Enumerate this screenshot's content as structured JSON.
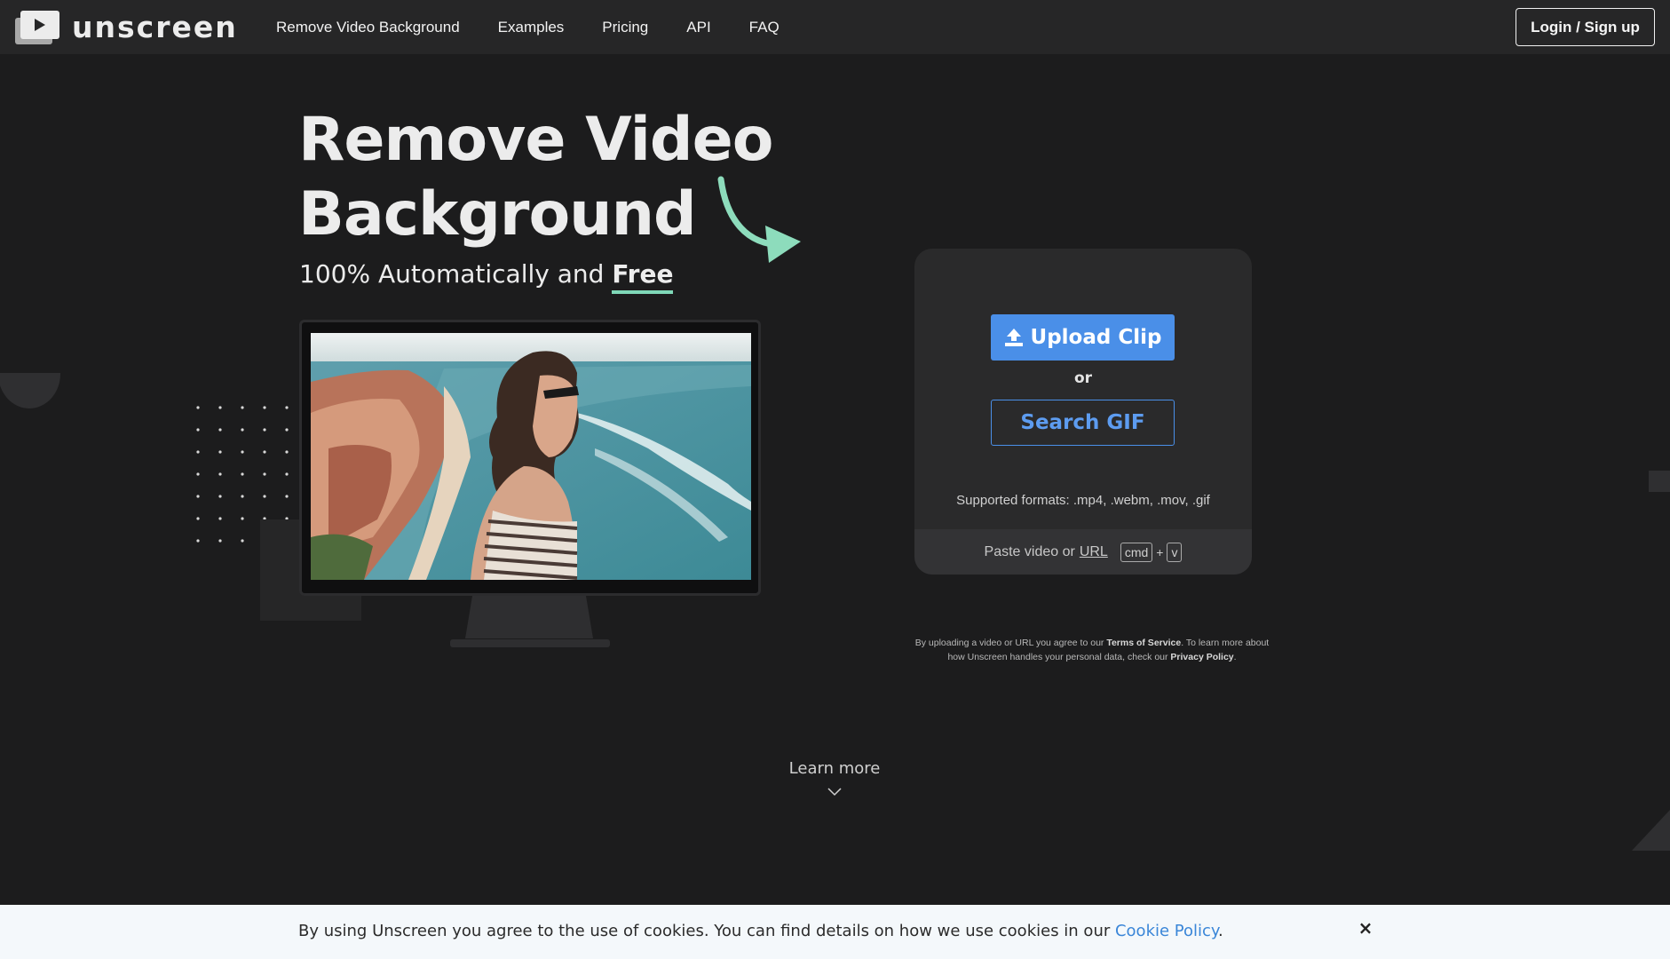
{
  "brand": {
    "name": "unscreen",
    "logo_icon": "play-screen-icon"
  },
  "nav": {
    "links": [
      "Remove Video Background",
      "Examples",
      "Pricing",
      "API",
      "FAQ"
    ],
    "login_label": "Login / Sign up"
  },
  "hero": {
    "title_line1": "Remove Video",
    "title_line2": "Background",
    "subtitle_prefix": "100% Automatically and ",
    "subtitle_emphasis": "Free"
  },
  "upload": {
    "upload_label": "Upload Clip",
    "upload_icon": "upload-icon",
    "or_label": "or",
    "search_label": "Search GIF",
    "formats": "Supported formats: .mp4, .webm, .mov, .gif",
    "paste_prefix": "Paste video or",
    "paste_url": "URL",
    "key_cmd": "cmd",
    "key_plus": "+",
    "key_v": "v"
  },
  "legal": {
    "part1": "By uploading a video or URL you agree to our ",
    "tos": "Terms of Service",
    "part2": ". To learn more about how Unscreen handles your personal data, check our ",
    "privacy": "Privacy Policy",
    "part3": "."
  },
  "learn_more": {
    "label": "Learn more",
    "icon": "chevron-down-icon"
  },
  "cookie": {
    "text": "By using Unscreen you agree to the use of cookies. You can find details on how we use cookies in our ",
    "link": "Cookie Policy",
    "end": ".",
    "close_label": "×"
  },
  "colors": {
    "background": "#1c1c1d",
    "nav": "#262627",
    "card": "#2a2a2b",
    "accent_blue": "#4a8fe8",
    "accent_green": "#7fd8b8",
    "cookie_bg": "#f4f8fb"
  }
}
